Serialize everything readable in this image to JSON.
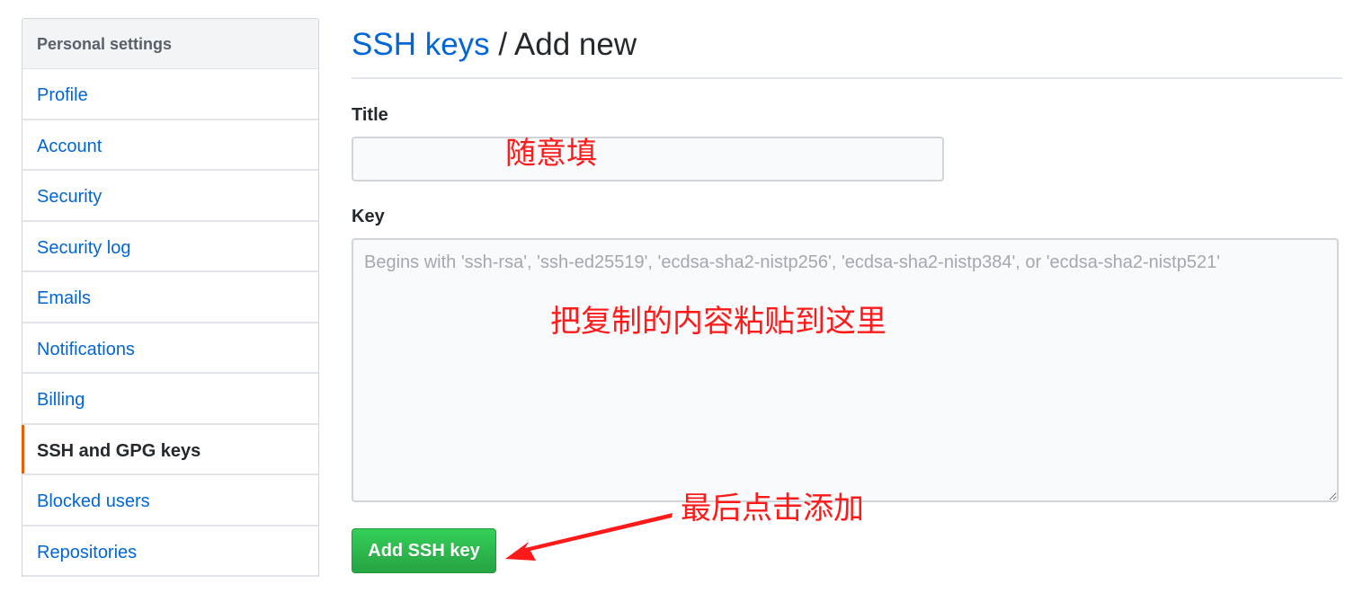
{
  "sidebar": {
    "header": "Personal settings",
    "items": [
      {
        "label": "Profile",
        "selected": false
      },
      {
        "label": "Account",
        "selected": false
      },
      {
        "label": "Security",
        "selected": false
      },
      {
        "label": "Security log",
        "selected": false
      },
      {
        "label": "Emails",
        "selected": false
      },
      {
        "label": "Notifications",
        "selected": false
      },
      {
        "label": "Billing",
        "selected": false
      },
      {
        "label": "SSH and GPG keys",
        "selected": true
      },
      {
        "label": "Blocked users",
        "selected": false
      },
      {
        "label": "Repositories",
        "selected": false
      }
    ]
  },
  "main": {
    "breadcrumb_link": "SSH keys",
    "breadcrumb_separator": " / ",
    "breadcrumb_current": "Add new",
    "title_label": "Title",
    "title_value": "",
    "key_label": "Key",
    "key_value": "",
    "key_placeholder": "Begins with 'ssh-rsa', 'ssh-ed25519', 'ecdsa-sha2-nistp256', 'ecdsa-sha2-nistp384', or 'ecdsa-sha2-nistp521'",
    "submit_label": "Add SSH key"
  },
  "annotations": {
    "title_note": "随意填",
    "key_note": "把复制的内容粘贴到这里",
    "button_note": "最后点击添加",
    "color": "#ff1a1a"
  },
  "colors": {
    "link": "#0366d6",
    "selected_indicator": "#e36209",
    "button_green": "#28a745"
  }
}
